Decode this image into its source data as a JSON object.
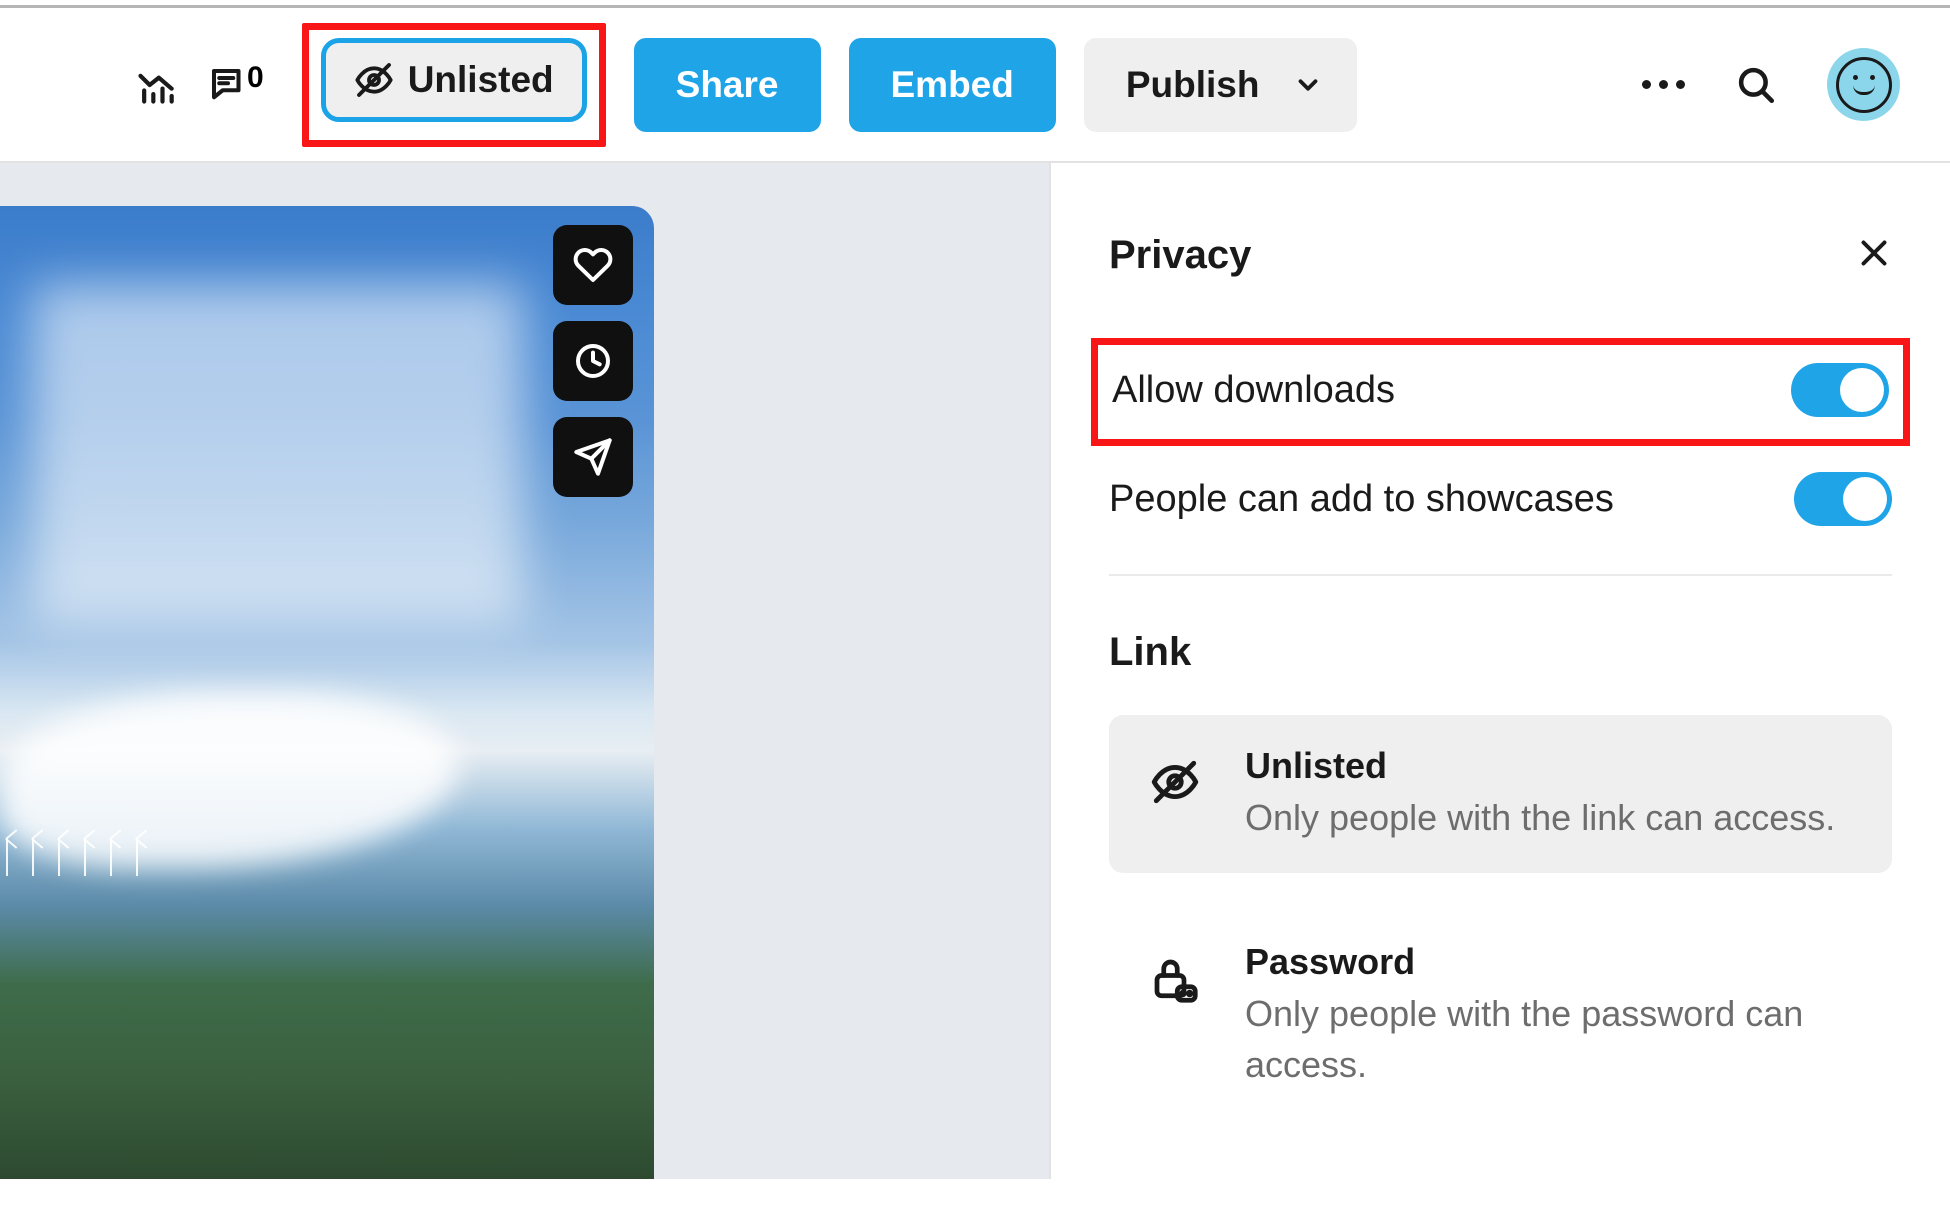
{
  "toolbar": {
    "comment_count": "0",
    "unlisted_label": "Unlisted",
    "share_label": "Share",
    "embed_label": "Embed",
    "publish_label": "Publish"
  },
  "panel": {
    "title": "Privacy",
    "allow_downloads_label": "Allow downloads",
    "allow_downloads_on": true,
    "showcases_label": "People can add to showcases",
    "showcases_on": true,
    "link_heading": "Link",
    "options": [
      {
        "title": "Unlisted",
        "desc": "Only people with the link can access.",
        "selected": true
      },
      {
        "title": "Password",
        "desc": "Only people with the password can access.",
        "selected": false
      }
    ]
  }
}
